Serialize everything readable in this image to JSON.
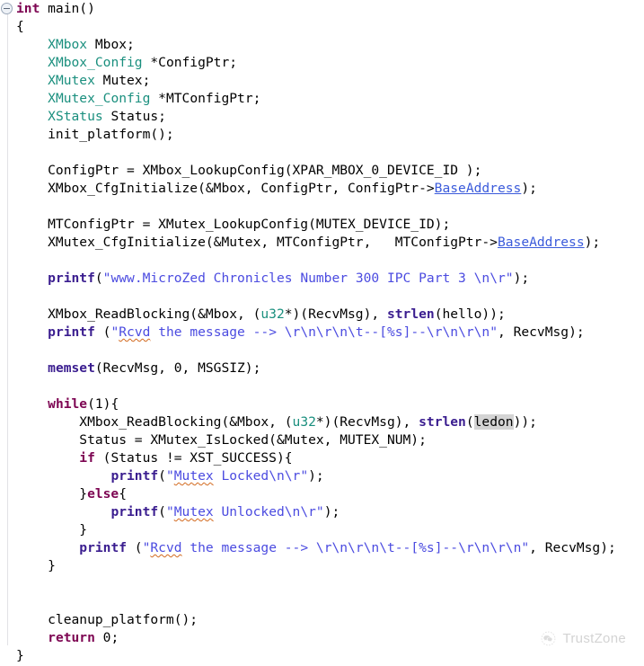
{
  "editor": {
    "language": "c",
    "folding": {
      "icon": "collapse-minus-icon",
      "expanded": true
    },
    "occurrence_highlight": "ledon",
    "colors": {
      "background": "#ffffff",
      "foreground": "#000000",
      "keyword": "#7d0552",
      "type": "#1a8f7e",
      "function": "#3a1d8f",
      "string": "#4b4be0",
      "field": "#3b5bdb",
      "spellcheck_squiggle": "#d2691e",
      "occurrence_highlight": "#d4d4d4",
      "fold_guide": "#e2e2e6"
    }
  },
  "code": {
    "lines": [
      [
        {
          "t": "int",
          "c": "kw"
        },
        {
          "t": " main()",
          "c": "pl"
        }
      ],
      [
        {
          "t": "{",
          "c": "pl"
        }
      ],
      [
        {
          "t": "    ",
          "c": "pl"
        },
        {
          "t": "XMbox",
          "c": "typ"
        },
        {
          "t": " Mbox;",
          "c": "pl"
        }
      ],
      [
        {
          "t": "    ",
          "c": "pl"
        },
        {
          "t": "XMbox_Config",
          "c": "typ"
        },
        {
          "t": " *ConfigPtr;",
          "c": "pl"
        }
      ],
      [
        {
          "t": "    ",
          "c": "pl"
        },
        {
          "t": "XMutex",
          "c": "typ"
        },
        {
          "t": " Mutex;",
          "c": "pl"
        }
      ],
      [
        {
          "t": "    ",
          "c": "pl"
        },
        {
          "t": "XMutex_Config",
          "c": "typ"
        },
        {
          "t": " *MTConfigPtr;",
          "c": "pl"
        }
      ],
      [
        {
          "t": "    ",
          "c": "pl"
        },
        {
          "t": "XStatus",
          "c": "typ"
        },
        {
          "t": " Status;",
          "c": "pl"
        }
      ],
      [
        {
          "t": "    init_platform();",
          "c": "pl"
        }
      ],
      [],
      [
        {
          "t": "    ConfigPtr = XMbox_LookupConfig(XPAR_MBOX_0_DEVICE_ID );",
          "c": "pl"
        }
      ],
      [
        {
          "t": "    XMbox_CfgInitialize(&Mbox, ConfigPtr, ConfigPtr->",
          "c": "pl"
        },
        {
          "t": "BaseAddress",
          "c": "fld"
        },
        {
          "t": ");",
          "c": "pl"
        }
      ],
      [],
      [
        {
          "t": "    MTConfigPtr = XMutex_LookupConfig(MUTEX_DEVICE_ID);",
          "c": "pl"
        }
      ],
      [
        {
          "t": "    XMutex_CfgInitialize(&Mutex, MTConfigPtr,   MTConfigPtr->",
          "c": "pl"
        },
        {
          "t": "BaseAddress",
          "c": "fld"
        },
        {
          "t": ");",
          "c": "pl"
        }
      ],
      [],
      [
        {
          "t": "    ",
          "c": "pl"
        },
        {
          "t": "printf",
          "c": "fn"
        },
        {
          "t": "(",
          "c": "pl"
        },
        {
          "t": "\"www.MicroZed Chronicles Number 300 IPC Part 3 \\n\\r\"",
          "c": "str"
        },
        {
          "t": ");",
          "c": "pl"
        }
      ],
      [],
      [
        {
          "t": "    XMbox_ReadBlocking(&Mbox, (",
          "c": "pl"
        },
        {
          "t": "u32",
          "c": "typ"
        },
        {
          "t": "*)(RecvMsg), ",
          "c": "pl"
        },
        {
          "t": "strlen",
          "c": "fn"
        },
        {
          "t": "(hello));",
          "c": "pl"
        }
      ],
      [
        {
          "t": "    ",
          "c": "pl"
        },
        {
          "t": "printf",
          "c": "fn"
        },
        {
          "t": " (",
          "c": "pl"
        },
        {
          "t": "\"",
          "c": "str"
        },
        {
          "t": "Rcvd",
          "c": "str sq"
        },
        {
          "t": " the message --> \\r\\n\\r\\n\\t--[%s]--\\r\\n\\r\\n\"",
          "c": "str"
        },
        {
          "t": ", RecvMsg);",
          "c": "pl"
        }
      ],
      [],
      [
        {
          "t": "    ",
          "c": "pl"
        },
        {
          "t": "memset",
          "c": "fn"
        },
        {
          "t": "(RecvMsg, 0, MSGSIZ);",
          "c": "pl"
        }
      ],
      [],
      [
        {
          "t": "    ",
          "c": "pl"
        },
        {
          "t": "while",
          "c": "kw"
        },
        {
          "t": "(1){",
          "c": "pl"
        }
      ],
      [
        {
          "t": "        XMbox_ReadBlocking(&Mbox, (",
          "c": "pl"
        },
        {
          "t": "u32",
          "c": "typ"
        },
        {
          "t": "*)(RecvMsg), ",
          "c": "pl"
        },
        {
          "t": "strlen",
          "c": "fn"
        },
        {
          "t": "(",
          "c": "pl"
        },
        {
          "t": "ledon",
          "c": "pl hl"
        },
        {
          "t": "));",
          "c": "pl"
        }
      ],
      [
        {
          "t": "        Status = XMutex_IsLocked(&Mutex, MUTEX_NUM);",
          "c": "pl"
        }
      ],
      [
        {
          "t": "        ",
          "c": "pl"
        },
        {
          "t": "if",
          "c": "kw"
        },
        {
          "t": " (Status != XST_SUCCESS){",
          "c": "pl"
        }
      ],
      [
        {
          "t": "            ",
          "c": "pl"
        },
        {
          "t": "printf",
          "c": "fn"
        },
        {
          "t": "(",
          "c": "pl"
        },
        {
          "t": "\"",
          "c": "str"
        },
        {
          "t": "Mutex",
          "c": "str sq"
        },
        {
          "t": " Locked\\n\\r\"",
          "c": "str"
        },
        {
          "t": ");",
          "c": "pl"
        }
      ],
      [
        {
          "t": "        }",
          "c": "pl"
        },
        {
          "t": "else",
          "c": "kw"
        },
        {
          "t": "{",
          "c": "pl"
        }
      ],
      [
        {
          "t": "            ",
          "c": "pl"
        },
        {
          "t": "printf",
          "c": "fn"
        },
        {
          "t": "(",
          "c": "pl"
        },
        {
          "t": "\"",
          "c": "str"
        },
        {
          "t": "Mutex",
          "c": "str sq"
        },
        {
          "t": " Unlocked\\n\\r\"",
          "c": "str"
        },
        {
          "t": ");",
          "c": "pl"
        }
      ],
      [
        {
          "t": "        }",
          "c": "pl"
        }
      ],
      [
        {
          "t": "        ",
          "c": "pl"
        },
        {
          "t": "printf",
          "c": "fn"
        },
        {
          "t": " (",
          "c": "pl"
        },
        {
          "t": "\"",
          "c": "str"
        },
        {
          "t": "Rcvd",
          "c": "str sq"
        },
        {
          "t": " the message --> \\r\\n\\r\\n\\t--[%s]--\\r\\n\\r\\n\"",
          "c": "str"
        },
        {
          "t": ", RecvMsg);",
          "c": "pl"
        }
      ],
      [
        {
          "t": "    }",
          "c": "pl"
        }
      ],
      [],
      [],
      [
        {
          "t": "    cleanup_platform();",
          "c": "pl"
        }
      ],
      [
        {
          "t": "    ",
          "c": "pl"
        },
        {
          "t": "return",
          "c": "kw"
        },
        {
          "t": " 0;",
          "c": "pl"
        }
      ],
      [
        {
          "t": "}",
          "c": "pl"
        }
      ]
    ]
  },
  "watermark": {
    "label": "TrustZone",
    "icon": "wechat-logo-icon"
  }
}
